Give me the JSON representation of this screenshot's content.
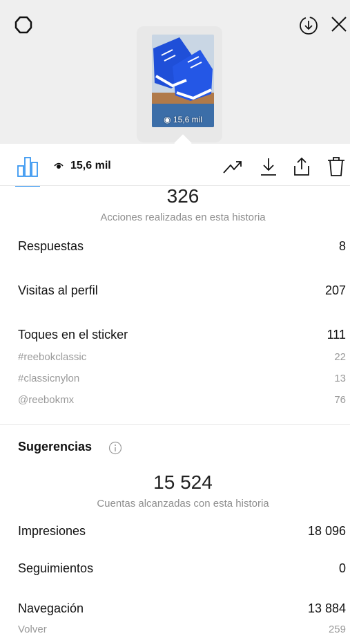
{
  "header": {
    "settings_icon": "gear-icon",
    "download_icon": "download-circle-icon",
    "close_icon": "close-icon",
    "thumbnail_views": "15,6 mil"
  },
  "toolbar": {
    "views": "15,6 mil",
    "icons": [
      "insights-icon",
      "eye-icon",
      "promote-trend-icon",
      "download-icon",
      "share-icon",
      "delete-icon"
    ],
    "accent_color": "#3897f0"
  },
  "actions": {
    "total": "326",
    "caption": "Acciones realizadas en esta historia",
    "rows": [
      {
        "label": "Respuestas",
        "value": "8"
      },
      {
        "label": "Visitas al perfil",
        "value": "207"
      },
      {
        "label": "Toques en el sticker",
        "value": "111"
      }
    ],
    "sticker_breakdown": [
      {
        "label": "#reebokclassic",
        "value": "22"
      },
      {
        "label": "#classicnylon",
        "value": "13"
      },
      {
        "label": "@reebokmx",
        "value": "76"
      }
    ]
  },
  "discovery": {
    "section_title": "Sugerencias",
    "total": "15 524",
    "caption": "Cuentas alcanzadas con esta historia",
    "rows": [
      {
        "label": "Impresiones",
        "value": "18 096"
      },
      {
        "label": "Seguimientos",
        "value": "0"
      },
      {
        "label": "Navegación",
        "value": "13 884"
      }
    ],
    "navigation_breakdown": [
      {
        "label": "Volver",
        "value": "259"
      }
    ]
  }
}
